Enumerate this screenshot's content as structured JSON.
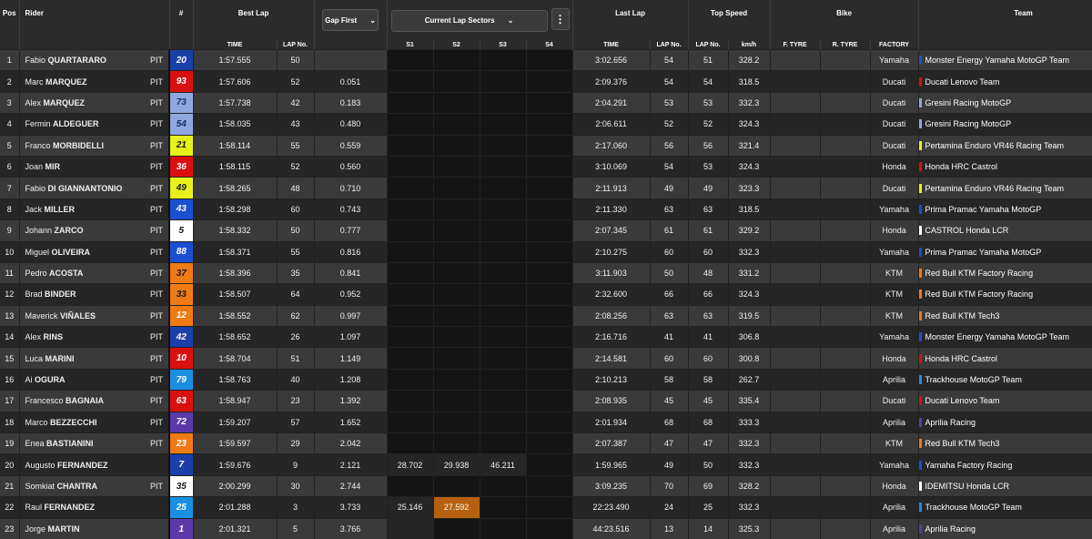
{
  "header": {
    "pos": "Pos",
    "rider": "Rider",
    "hash": "#",
    "best_lap": "Best Lap",
    "gap_select": "Gap First",
    "sectors_select": "Current Lap Sectors",
    "last_lap": "Last Lap",
    "top_speed": "Top Speed",
    "bike": "Bike",
    "team": "Team",
    "sub": {
      "time": "TIME",
      "lap_no": "LAP No.",
      "s1": "S1",
      "s2": "S2",
      "s3": "S3",
      "s4": "S4",
      "last_time": "TIME",
      "last_lap_no": "LAP No.",
      "ts_lap_no": "LAP No.",
      "kmh": "km/h",
      "ftyre": "F. TYRE",
      "rtyre": "R. TYRE",
      "factory": "FACTORY"
    }
  },
  "rows": [
    {
      "pos": "1",
      "first": "Fabio",
      "last": "QUARTARARO",
      "pit": "PIT",
      "num": "20",
      "numbg": "#1b3fa8",
      "numfg": "#ffffff",
      "best": "1:57.555",
      "blap": "50",
      "gap": "",
      "s1": "",
      "s2": "",
      "s3": "",
      "s4": "",
      "ltime": "3:02.656",
      "llap": "54",
      "tslap": "51",
      "kmh": "328.2",
      "factory": "Yamaha",
      "team": "Monster Energy Yamaha MotoGP Team",
      "tcolor": "#1f4fd1"
    },
    {
      "pos": "2",
      "first": "Marc",
      "last": "MARQUEZ",
      "pit": "PIT",
      "num": "93",
      "numbg": "#d91010",
      "numfg": "#ffffff",
      "best": "1:57.606",
      "blap": "52",
      "gap": "0.051",
      "s1": "",
      "s2": "",
      "s3": "",
      "s4": "",
      "ltime": "2:09.376",
      "llap": "54",
      "tslap": "54",
      "kmh": "318.5",
      "factory": "Ducati",
      "team": "Ducati Lenovo Team",
      "tcolor": "#d91010"
    },
    {
      "pos": "3",
      "first": "Alex",
      "last": "MARQUEZ",
      "pit": "PIT",
      "num": "73",
      "numbg": "#8fa8e0",
      "numfg": "#1a2f6b",
      "best": "1:57.738",
      "blap": "42",
      "gap": "0.183",
      "s1": "",
      "s2": "",
      "s3": "",
      "s4": "",
      "ltime": "2:04.291",
      "llap": "53",
      "tslap": "53",
      "kmh": "332.3",
      "factory": "Ducati",
      "team": "Gresini Racing MotoGP",
      "tcolor": "#8fa8e0"
    },
    {
      "pos": "4",
      "first": "Fermin",
      "last": "ALDEGUER",
      "pit": "PIT",
      "num": "54",
      "numbg": "#8fa8e0",
      "numfg": "#1a2f6b",
      "best": "1:58.035",
      "blap": "43",
      "gap": "0.480",
      "s1": "",
      "s2": "",
      "s3": "",
      "s4": "",
      "ltime": "2:06.611",
      "llap": "52",
      "tslap": "52",
      "kmh": "324.3",
      "factory": "Ducati",
      "team": "Gresini Racing MotoGP",
      "tcolor": "#8fa8e0"
    },
    {
      "pos": "5",
      "first": "Franco",
      "last": "MORBIDELLI",
      "pit": "PIT",
      "num": "21",
      "numbg": "#e8f21a",
      "numfg": "#1a1a1a",
      "best": "1:58.114",
      "blap": "55",
      "gap": "0.559",
      "s1": "",
      "s2": "",
      "s3": "",
      "s4": "",
      "ltime": "2:17.060",
      "llap": "56",
      "tslap": "56",
      "kmh": "321.4",
      "factory": "Ducati",
      "team": "Pertamina Enduro VR46 Racing Team",
      "tcolor": "#e8f21a"
    },
    {
      "pos": "6",
      "first": "Joan",
      "last": "MIR",
      "pit": "PIT",
      "num": "36",
      "numbg": "#d91010",
      "numfg": "#ffffff",
      "best": "1:58.115",
      "blap": "52",
      "gap": "0.560",
      "s1": "",
      "s2": "",
      "s3": "",
      "s4": "",
      "ltime": "3:10.069",
      "llap": "54",
      "tslap": "53",
      "kmh": "324.3",
      "factory": "Honda",
      "team": "Honda HRC Castrol",
      "tcolor": "#d91010"
    },
    {
      "pos": "7",
      "first": "Fabio",
      "last": "DI GIANNANTONIO",
      "pit": "PIT",
      "num": "49",
      "numbg": "#e8f21a",
      "numfg": "#1a1a1a",
      "best": "1:58.265",
      "blap": "48",
      "gap": "0.710",
      "s1": "",
      "s2": "",
      "s3": "",
      "s4": "",
      "ltime": "2:11.913",
      "llap": "49",
      "tslap": "49",
      "kmh": "323.3",
      "factory": "Ducati",
      "team": "Pertamina Enduro VR46 Racing Team",
      "tcolor": "#e8f21a"
    },
    {
      "pos": "8",
      "first": "Jack",
      "last": "MILLER",
      "pit": "PIT",
      "num": "43",
      "numbg": "#1b4fd1",
      "numfg": "#ffffff",
      "best": "1:58.298",
      "blap": "60",
      "gap": "0.743",
      "s1": "",
      "s2": "",
      "s3": "",
      "s4": "",
      "ltime": "2:11.330",
      "llap": "63",
      "tslap": "63",
      "kmh": "318.5",
      "factory": "Yamaha",
      "team": "Prima Pramac Yamaha MotoGP",
      "tcolor": "#1b4fd1"
    },
    {
      "pos": "9",
      "first": "Johann",
      "last": "ZARCO",
      "pit": "PIT",
      "num": "5",
      "numbg": "#ffffff",
      "numfg": "#1a1a1a",
      "best": "1:58.332",
      "blap": "50",
      "gap": "0.777",
      "s1": "",
      "s2": "",
      "s3": "",
      "s4": "",
      "ltime": "2:07.345",
      "llap": "61",
      "tslap": "61",
      "kmh": "329.2",
      "factory": "Honda",
      "team": "CASTROL Honda LCR",
      "tcolor": "#ffffff"
    },
    {
      "pos": "10",
      "first": "Miguel",
      "last": "OLIVEIRA",
      "pit": "PIT",
      "num": "88",
      "numbg": "#1b4fd1",
      "numfg": "#ffffff",
      "best": "1:58.371",
      "blap": "55",
      "gap": "0.816",
      "s1": "",
      "s2": "",
      "s3": "",
      "s4": "",
      "ltime": "2:10.275",
      "llap": "60",
      "tslap": "60",
      "kmh": "332.3",
      "factory": "Yamaha",
      "team": "Prima Pramac Yamaha MotoGP",
      "tcolor": "#1b4fd1"
    },
    {
      "pos": "11",
      "first": "Pedro",
      "last": "ACOSTA",
      "pit": "PIT",
      "num": "37",
      "numbg": "#f07a14",
      "numfg": "#1a1a1a",
      "best": "1:58.396",
      "blap": "35",
      "gap": "0.841",
      "s1": "",
      "s2": "",
      "s3": "",
      "s4": "",
      "ltime": "3:11.903",
      "llap": "50",
      "tslap": "48",
      "kmh": "331.2",
      "factory": "KTM",
      "team": "Red Bull KTM Factory Racing",
      "tcolor": "#f07a14"
    },
    {
      "pos": "12",
      "first": "Brad",
      "last": "BINDER",
      "pit": "PIT",
      "num": "33",
      "numbg": "#f07a14",
      "numfg": "#1a1a1a",
      "best": "1:58.507",
      "blap": "64",
      "gap": "0.952",
      "s1": "",
      "s2": "",
      "s3": "",
      "s4": "",
      "ltime": "2:32.600",
      "llap": "66",
      "tslap": "66",
      "kmh": "324.3",
      "factory": "KTM",
      "team": "Red Bull KTM Factory Racing",
      "tcolor": "#f07a14"
    },
    {
      "pos": "13",
      "first": "Maverick",
      "last": "VIÑALES",
      "pit": "PIT",
      "num": "12",
      "numbg": "#f07a14",
      "numfg": "#ffffff",
      "best": "1:58.552",
      "blap": "62",
      "gap": "0.997",
      "s1": "",
      "s2": "",
      "s3": "",
      "s4": "",
      "ltime": "2:08.256",
      "llap": "63",
      "tslap": "63",
      "kmh": "319.5",
      "factory": "KTM",
      "team": "Red Bull KTM Tech3",
      "tcolor": "#f07a14"
    },
    {
      "pos": "14",
      "first": "Alex",
      "last": "RINS",
      "pit": "PIT",
      "num": "42",
      "numbg": "#1b3fa8",
      "numfg": "#ffffff",
      "best": "1:58.652",
      "blap": "26",
      "gap": "1.097",
      "s1": "",
      "s2": "",
      "s3": "",
      "s4": "",
      "ltime": "2:16.716",
      "llap": "41",
      "tslap": "41",
      "kmh": "306.8",
      "factory": "Yamaha",
      "team": "Monster Energy Yamaha MotoGP Team",
      "tcolor": "#1f4fd1"
    },
    {
      "pos": "15",
      "first": "Luca",
      "last": "MARINI",
      "pit": "PIT",
      "num": "10",
      "numbg": "#d91010",
      "numfg": "#ffffff",
      "best": "1:58.704",
      "blap": "51",
      "gap": "1.149",
      "s1": "",
      "s2": "",
      "s3": "",
      "s4": "",
      "ltime": "2:14.581",
      "llap": "60",
      "tslap": "60",
      "kmh": "300.8",
      "factory": "Honda",
      "team": "Honda HRC Castrol",
      "tcolor": "#d91010"
    },
    {
      "pos": "16",
      "first": "Ai",
      "last": "OGURA",
      "pit": "PIT",
      "num": "79",
      "numbg": "#1a8fe0",
      "numfg": "#ffffff",
      "best": "1:58.763",
      "blap": "40",
      "gap": "1.208",
      "s1": "",
      "s2": "",
      "s3": "",
      "s4": "",
      "ltime": "2:10.213",
      "llap": "58",
      "tslap": "58",
      "kmh": "262.7",
      "factory": "Aprilia",
      "team": "Trackhouse MotoGP Team",
      "tcolor": "#1a8fe0"
    },
    {
      "pos": "17",
      "first": "Francesco",
      "last": "BAGNAIA",
      "pit": "PIT",
      "num": "63",
      "numbg": "#d91010",
      "numfg": "#ffffff",
      "best": "1:58.947",
      "blap": "23",
      "gap": "1.392",
      "s1": "",
      "s2": "",
      "s3": "",
      "s4": "",
      "ltime": "2:08.935",
      "llap": "45",
      "tslap": "45",
      "kmh": "335.4",
      "factory": "Ducati",
      "team": "Ducati Lenovo Team",
      "tcolor": "#d91010"
    },
    {
      "pos": "18",
      "first": "Marco",
      "last": "BEZZECCHI",
      "pit": "PIT",
      "num": "72",
      "numbg": "#5a3aa8",
      "numfg": "#ffffff",
      "best": "1:59.207",
      "blap": "57",
      "gap": "1.652",
      "s1": "",
      "s2": "",
      "s3": "",
      "s4": "",
      "ltime": "2:01.934",
      "llap": "68",
      "tslap": "68",
      "kmh": "333.3",
      "factory": "Aprilia",
      "team": "Aprilia Racing",
      "tcolor": "#5a3aa8"
    },
    {
      "pos": "19",
      "first": "Enea",
      "last": "BASTIANINI",
      "pit": "PIT",
      "num": "23",
      "numbg": "#f07a14",
      "numfg": "#ffffff",
      "best": "1:59.597",
      "blap": "29",
      "gap": "2.042",
      "s1": "",
      "s2": "",
      "s3": "",
      "s4": "",
      "ltime": "2:07.387",
      "llap": "47",
      "tslap": "47",
      "kmh": "332.3",
      "factory": "KTM",
      "team": "Red Bull KTM Tech3",
      "tcolor": "#f07a14"
    },
    {
      "pos": "20",
      "first": "Augusto",
      "last": "FERNANDEZ",
      "pit": "",
      "num": "7",
      "numbg": "#1b3fa8",
      "numfg": "#ffffff",
      "best": "1:59.676",
      "blap": "9",
      "gap": "2.121",
      "s1": "28.702",
      "s2": "29.938",
      "s3": "46.211",
      "s4": "",
      "ltime": "1:59.965",
      "llap": "49",
      "tslap": "50",
      "kmh": "332.3",
      "factory": "Yamaha",
      "team": "Yamaha Factory Racing",
      "tcolor": "#1f4fd1",
      "secfill": [
        1,
        1,
        1,
        0
      ]
    },
    {
      "pos": "21",
      "first": "Somkiat",
      "last": "CHANTRA",
      "pit": "PIT",
      "num": "35",
      "numbg": "#ffffff",
      "numfg": "#1a1a1a",
      "best": "2:00.299",
      "blap": "30",
      "gap": "2.744",
      "s1": "",
      "s2": "",
      "s3": "",
      "s4": "",
      "ltime": "3:09.235",
      "llap": "70",
      "tslap": "69",
      "kmh": "328.2",
      "factory": "Honda",
      "team": "IDEMITSU Honda LCR",
      "tcolor": "#ffffff"
    },
    {
      "pos": "22",
      "first": "Raul",
      "last": "FERNANDEZ",
      "pit": "",
      "num": "25",
      "numbg": "#1a8fe0",
      "numfg": "#ffffff",
      "best": "2:01.288",
      "blap": "3",
      "gap": "3.733",
      "s1": "25.146",
      "s2": "27.592",
      "s3": "",
      "s4": "",
      "ltime": "22:23.490",
      "llap": "24",
      "tslap": "25",
      "kmh": "332.3",
      "factory": "Aprilia",
      "team": "Trackhouse MotoGP Team",
      "tcolor": "#1a8fe0",
      "secfill": [
        1,
        2,
        0,
        0
      ]
    },
    {
      "pos": "23",
      "first": "Jorge",
      "last": "MARTIN",
      "pit": "",
      "num": "1",
      "numbg": "#5a3aa8",
      "numfg": "#ffffff",
      "best": "2:01.321",
      "blap": "5",
      "gap": "3.766",
      "s1": "",
      "s2": "",
      "s3": "",
      "s4": "",
      "ltime": "44:23.516",
      "llap": "13",
      "tslap": "14",
      "kmh": "325.3",
      "factory": "Aprilia",
      "team": "Aprilia Racing",
      "tcolor": "#5a3aa8",
      "secfill": [
        1,
        0,
        0,
        0
      ]
    }
  ]
}
